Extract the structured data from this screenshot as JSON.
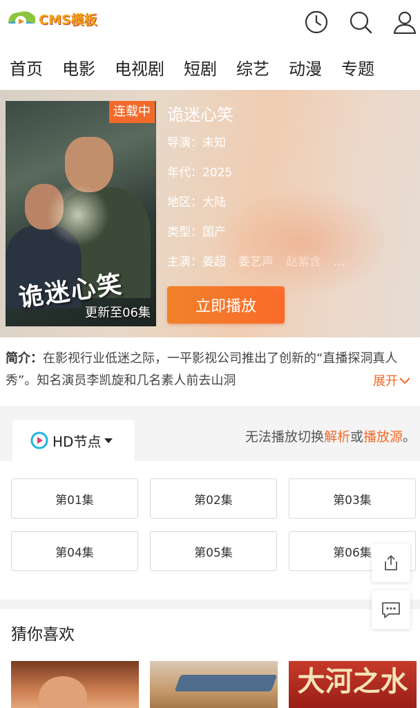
{
  "header": {
    "logo_text": "CMS模板",
    "icons": [
      "history-icon",
      "search-icon",
      "user-icon"
    ]
  },
  "nav": {
    "items": [
      "首页",
      "电影",
      "电视剧",
      "短剧",
      "综艺",
      "动漫",
      "专题"
    ]
  },
  "detail": {
    "status_badge": "连载中",
    "update_text": "更新至06集",
    "title": "诡迷心笑",
    "director_label": "导演：",
    "director": "未知",
    "year_label": "年代：",
    "year": "2025",
    "region_label": "地区：",
    "region": "大陆",
    "genre_label": "类型：",
    "genre": "国产",
    "cast_label": "主演：",
    "cast": [
      "姜超",
      "姜艺声",
      "赵紫含",
      "..."
    ],
    "play_label": "立即播放",
    "poster_title": "诡迷心笑"
  },
  "intro": {
    "label": "简介：",
    "text": "在影视行业低迷之际，一平影视公司推出了创新的“直播探洞真人秀”。知名演员李凯旋和几名素人前去山洞",
    "expand_label": "展开"
  },
  "source": {
    "tab_label": "HD节点",
    "note_prefix": "无法播放切换",
    "note_link1": "解析",
    "note_mid": "或",
    "note_link2": "播放源",
    "note_suffix": "。"
  },
  "episodes": [
    "第01集",
    "第02集",
    "第03集",
    "第04集",
    "第05集",
    "第06集"
  ],
  "recommend": {
    "title": "猜你喜欢",
    "thumb3_text": "大河之水"
  },
  "colors": {
    "accent": "#f26a2a",
    "play_button": "#fb6a2a"
  }
}
